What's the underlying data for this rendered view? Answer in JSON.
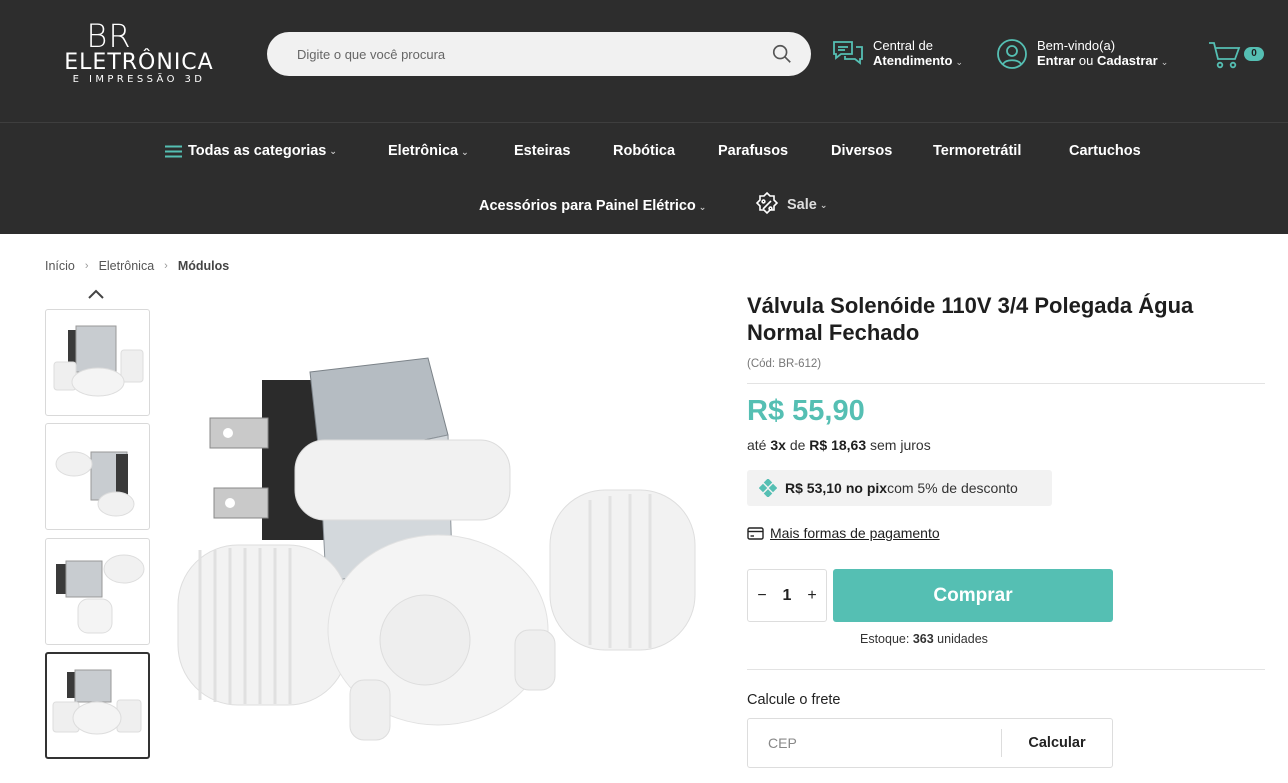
{
  "brand": {
    "line1": "BR",
    "line2": "ELETRÔNICA",
    "line3": "E IMPRESSÃO 3D"
  },
  "search": {
    "placeholder": "Digite o que você procura",
    "icon": "search-icon"
  },
  "support": {
    "line1": "Central de",
    "line2": "Atendimento",
    "icon": "chat-bubbles-icon"
  },
  "account": {
    "line1": "Bem-vindo(a)",
    "login": "Entrar",
    "or": "ou",
    "register": "Cadastrar",
    "icon": "user-icon"
  },
  "cart": {
    "count": "0",
    "icon": "cart-icon"
  },
  "nav": {
    "all": "Todas as categorias",
    "items": [
      "Eletrônica",
      "Esteiras",
      "Robótica",
      "Parafusos",
      "Diversos",
      "Termoretrátil",
      "Cartuchos"
    ],
    "row2": [
      "Acessórios para Painel Elétrico",
      "Sale"
    ]
  },
  "breadcrumb": [
    "Início",
    "Eletrônica",
    "Módulos"
  ],
  "product": {
    "title": "Válvula Solenóide 110V 3/4 Polegada Água Normal Fechado",
    "code": "(Cód: BR-612)",
    "price": "R$ 55,90",
    "installments": {
      "prefix": "até",
      "count": "3x",
      "mid": "de",
      "value": "R$ 18,63",
      "suffix": "sem juros"
    },
    "pix": {
      "value": "R$ 53,10",
      "label": "no pix",
      "suffix": "com 5% de desconto"
    },
    "more_payment": "Mais formas de pagamento",
    "quantity": "1",
    "minus": "−",
    "plus": "+",
    "buy": "Comprar",
    "stock": {
      "label": "Estoque:",
      "value": "363",
      "unit": "unidades"
    }
  },
  "shipping": {
    "label": "Calcule o frete",
    "placeholder": "CEP",
    "button": "Calcular"
  },
  "colors": {
    "accent": "#55bfb3",
    "header": "#2d2d2d"
  }
}
